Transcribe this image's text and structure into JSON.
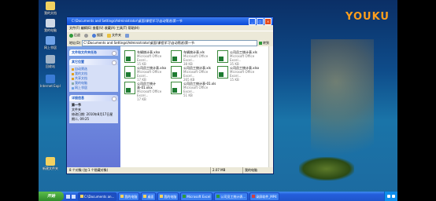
{
  "overlay": {
    "logo": "YOUKU",
    "logo_accent": "#ff9f1c"
  },
  "desktop_icons": [
    {
      "label": "我的文档",
      "color": "#f2d160"
    },
    {
      "label": "我的电脑",
      "color": "#cfd8e6"
    },
    {
      "label": "网上邻居",
      "color": "#6fa2e8"
    },
    {
      "label": "回收站",
      "color": "#9fb3c8"
    },
    {
      "label": "Internet Explorer",
      "color": "#3a7bd5"
    },
    {
      "label": "新建文件夹",
      "color": "#f2d160"
    }
  ],
  "window": {
    "title": "C:\\Documents and Settings\\Administrator\\桌面\\课程学习\\自动筛选\\第一节",
    "menu": "文件(F)  编辑(E)  查看(V)  收藏(A)  工具(T)  帮助(H)",
    "toolbar": {
      "back": "后退",
      "search": "搜索",
      "folders": "文件夹"
    },
    "address_label": "地址(D)",
    "address_value": "C:\\Documents and Settings\\Administrator\\桌面\\课程学习\\自动筛选\\第一节",
    "go_label": "转到"
  },
  "tasks": {
    "file_tasks_title": "文件和文件夹任务",
    "other_places_title": "其它位置",
    "other_places": [
      "自动筛选",
      "我的文档",
      "共享文档",
      "我的电脑",
      "网上邻居"
    ],
    "details_title": "详细信息",
    "details_name": "第一节",
    "details_type": "文件夹",
    "details_modified": "修改日期: 2010年8月17日星期二, 09:25"
  },
  "files": [
    {
      "name": "车辆统计表.xlsx",
      "type": "Microsoft Office Excel...",
      "size": "15 KB"
    },
    {
      "name": "车辆统计表.xls",
      "type": "Microsoft Office Excel...",
      "size": "38 KB"
    },
    {
      "name": "公司员工统计表.xls",
      "type": "Microsoft Office Excel...",
      "size": "35 KB"
    },
    {
      "name": "公司员工统计表.xlsx",
      "type": "Microsoft Office Excel...",
      "size": "17 KB"
    },
    {
      "name": "公司员工统计表.xls",
      "type": "Microsoft Office Excel...",
      "size": "265 KB"
    },
    {
      "name": "公司员工统计表.xlsx",
      "type": "Microsoft Office Excel...",
      "size": "15 KB"
    },
    {
      "name": "公司员工统计表-01.xlsx",
      "type": "Microsoft Office Excel...",
      "size": "17 KB"
    },
    {
      "name": "公司员工统计表-01.xls",
      "type": "Microsoft Office Excel...",
      "size": "51 KB"
    }
  ],
  "statusbar": {
    "count": "8 个对象 (加 1 个隐藏对象)",
    "size": "2.07 MB",
    "location": "我的电脑"
  },
  "taskbar": {
    "start": "开始",
    "tasks": [
      "C:\\Documents an...",
      "我的电脑",
      "桌面",
      "我的电脑",
      "Microsoft Excel",
      "公司员工统计表...",
      "录屏软件_MP4",
      "屏幕录像"
    ],
    "clock": ""
  }
}
